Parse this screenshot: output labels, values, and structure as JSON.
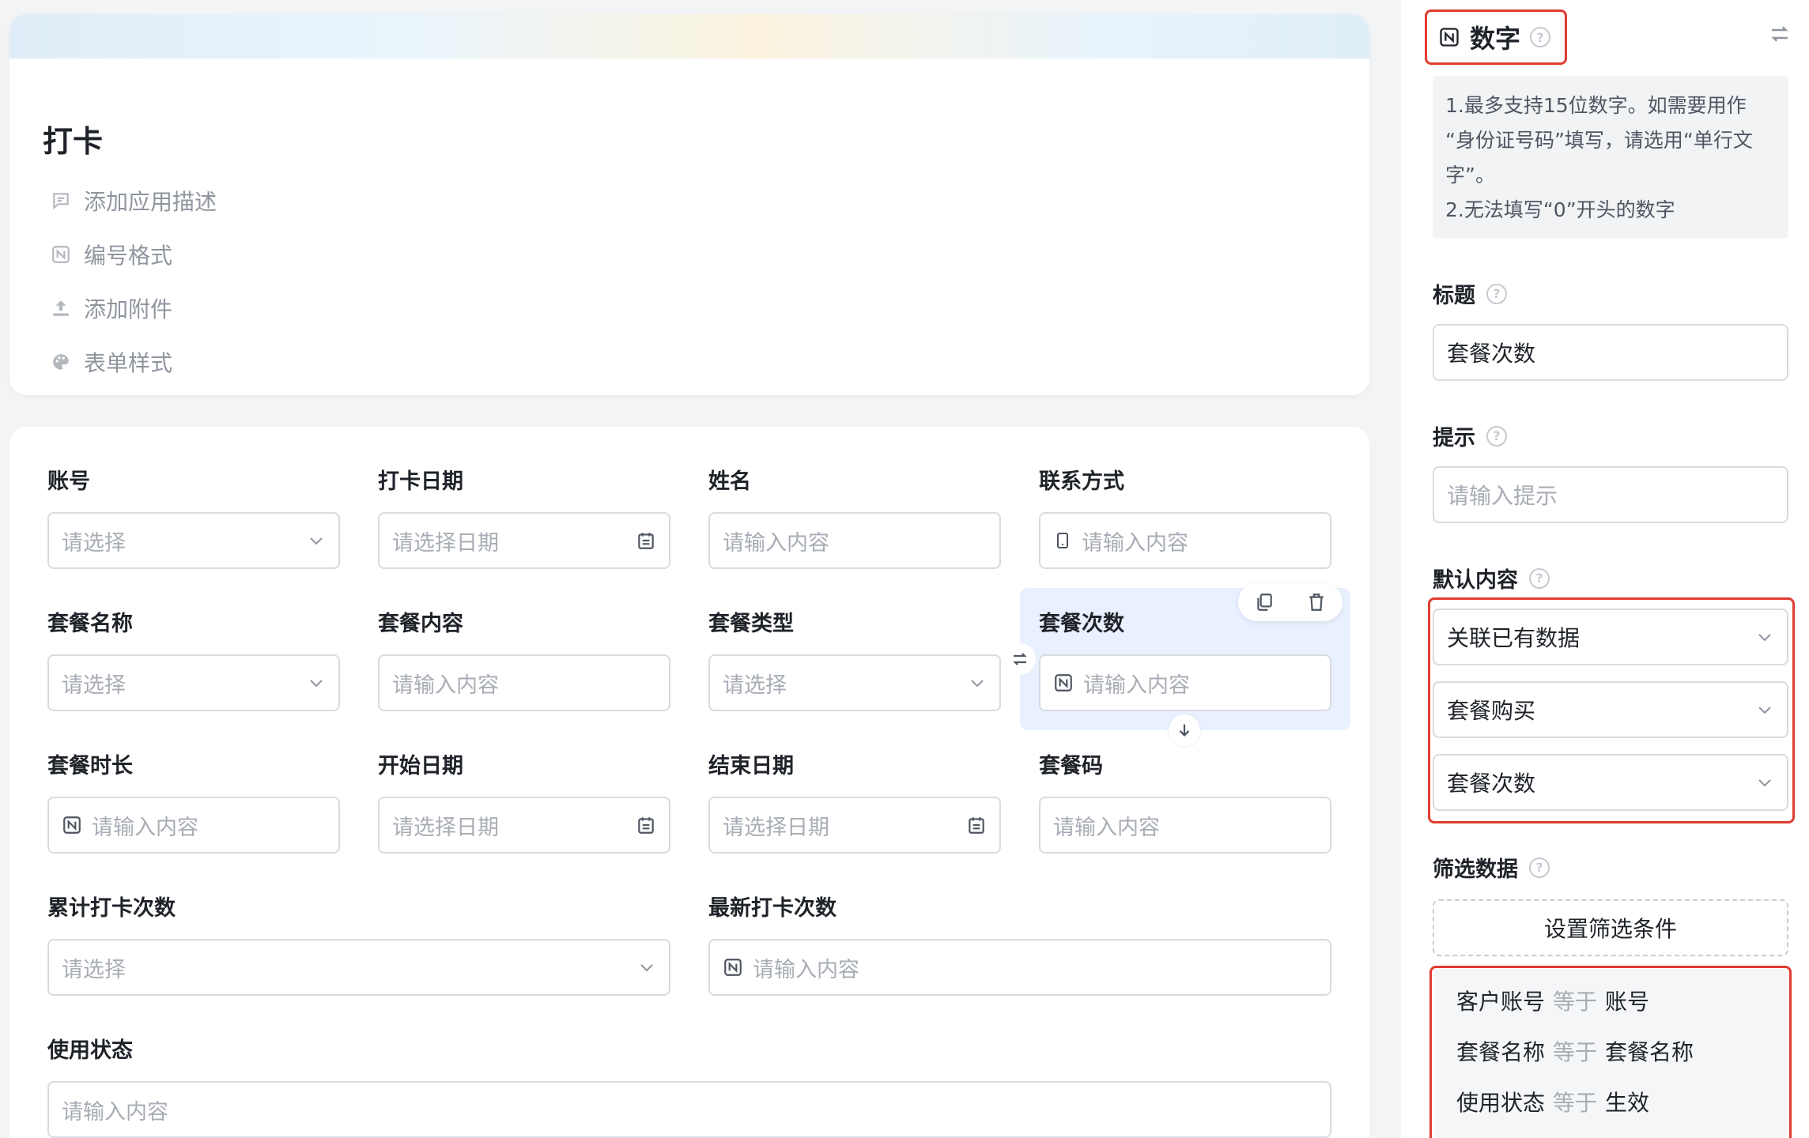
{
  "app": {
    "title": "打卡",
    "meta": [
      "添加应用描述",
      "编号格式",
      "添加附件",
      "表单样式"
    ]
  },
  "form": {
    "fields": [
      {
        "label": "账号",
        "placeholder": "请选择",
        "icon": "chevron-down-icon"
      },
      {
        "label": "打卡日期",
        "placeholder": "请选择日期",
        "icon": "calendar-icon"
      },
      {
        "label": "姓名",
        "placeholder": "请输入内容",
        "icon": ""
      },
      {
        "label": "联系方式",
        "placeholder": "请输入内容",
        "icon": "phone-icon"
      },
      {
        "label": "套餐名称",
        "placeholder": "请选择",
        "icon": "chevron-down-icon"
      },
      {
        "label": "套餐内容",
        "placeholder": "请输入内容",
        "icon": ""
      },
      {
        "label": "套餐类型",
        "placeholder": "请选择",
        "icon": "chevron-down-icon"
      },
      {
        "label": "套餐次数",
        "placeholder": "请输入内容",
        "icon": "number-icon",
        "selected": true
      },
      {
        "label": "套餐时长",
        "placeholder": "请输入内容",
        "icon": "number-icon"
      },
      {
        "label": "开始日期",
        "placeholder": "请选择日期",
        "icon": "calendar-icon"
      },
      {
        "label": "结束日期",
        "placeholder": "请选择日期",
        "icon": "calendar-icon"
      },
      {
        "label": "套餐码",
        "placeholder": "请输入内容",
        "icon": ""
      },
      {
        "label": "累计打卡次数",
        "placeholder": "请选择",
        "icon": "chevron-down-icon"
      },
      {
        "label": "最新打卡次数",
        "placeholder": "请输入内容",
        "icon": "number-icon"
      },
      {
        "label": "使用状态",
        "placeholder": "请输入内容",
        "icon": ""
      }
    ]
  },
  "panel": {
    "field_type": "数字",
    "notice": [
      "1.最多支持15位数字。如需要用作",
      "“身份证号码”填写，请选用“单行文",
      "字”。",
      "2.无法填写“0”开头的数字"
    ],
    "title_label": "标题",
    "title_value": "套餐次数",
    "hint_label": "提示",
    "hint_placeholder": "请输入提示",
    "default_label": "默认内容",
    "default_selects": [
      "关联已有数据",
      "套餐购买",
      "套餐次数"
    ],
    "filter_label": "筛选数据",
    "filter_button": "设置筛选条件",
    "conditions": [
      {
        "field": "客户账号",
        "op": "等于",
        "value": "账号"
      },
      {
        "field": "套餐名称",
        "op": "等于",
        "value": "套餐名称"
      },
      {
        "field": "使用状态",
        "op": "等于",
        "value": "生效"
      }
    ]
  },
  "colors": {
    "highlight": "#e03c31",
    "selected_bg": "#e9f0ff",
    "border": "#d8dbe0"
  }
}
